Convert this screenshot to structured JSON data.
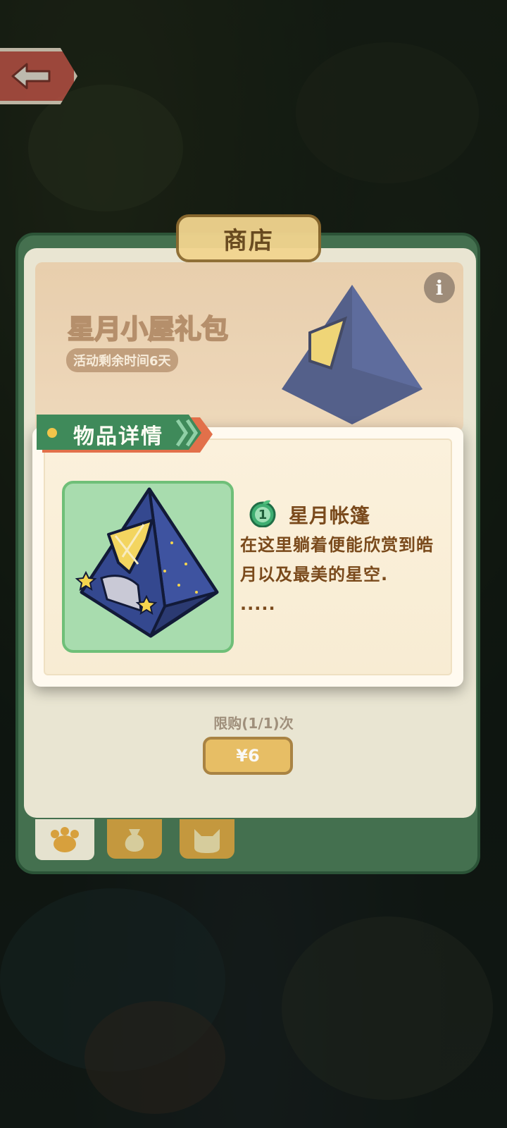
{
  "shop": {
    "title": "商店",
    "banner": {
      "title": "星月小屋礼包",
      "timer": "活动剩余时间6天",
      "info_icon": "i"
    },
    "limit_text": "限购(1/1)次",
    "price_label": "¥6",
    "tabs": [
      {
        "icon": "cat-paw-icon"
      },
      {
        "icon": "bag-icon"
      },
      {
        "icon": "cat-face-icon"
      }
    ]
  },
  "detail": {
    "ribbon_label": "物品详情",
    "item_level": "1",
    "item_name": "星月帐篷",
    "item_description": "在这里躺着便能欣赏到皓月以及最美的星空.",
    "item_description_more": "....."
  },
  "colors": {
    "ribbon_green": "#3f8a5a",
    "ribbon_orange": "#e2704a",
    "text_brown": "#7a4a1c",
    "card_green": "#a8dcae"
  }
}
